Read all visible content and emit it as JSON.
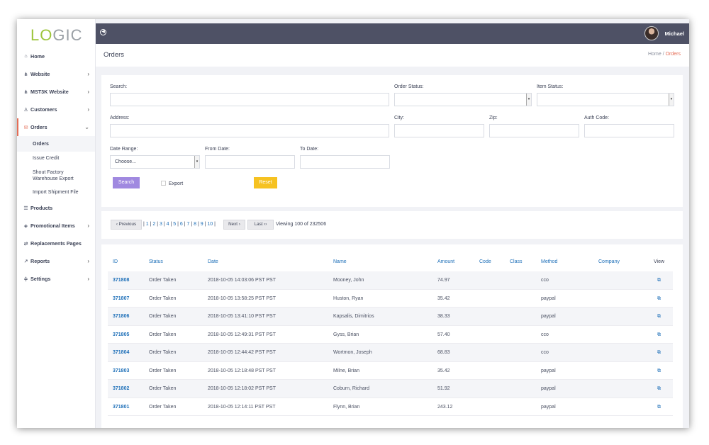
{
  "app": {
    "logo_a": "LO",
    "logo_b": "GIC",
    "user": "Michael"
  },
  "sidebar": {
    "items": [
      {
        "label": "Home",
        "icon": "home-icon",
        "glyph": "⌂"
      },
      {
        "label": "Website",
        "icon": "sitemap-icon",
        "glyph": "⋔"
      },
      {
        "label": "MST3K Website",
        "icon": "sitemap-icon",
        "glyph": "⋔"
      },
      {
        "label": "Customers",
        "icon": "users-icon",
        "glyph": "♙"
      },
      {
        "label": "Orders",
        "icon": "envelope-icon",
        "glyph": "✉"
      },
      {
        "label": "Products",
        "icon": "list-icon",
        "glyph": "☰"
      },
      {
        "label": "Promotional Items",
        "icon": "tags-icon",
        "glyph": "◈"
      },
      {
        "label": "Replacements Pages",
        "icon": "exchange-icon",
        "glyph": "⇄"
      },
      {
        "label": "Reports",
        "icon": "chart-icon",
        "glyph": "↗"
      },
      {
        "label": "Settings",
        "icon": "sliders-icon",
        "glyph": "≑"
      }
    ],
    "orders_sub": [
      "Orders",
      "Issue Credit",
      "Shout Factory Warehouse Export",
      "Import Shipment File"
    ]
  },
  "header": {
    "title": "Orders",
    "crumb_home": "Home",
    "crumb_sep": "/",
    "crumb_current": "Orders"
  },
  "filters": {
    "search": "Search:",
    "order_status": "Order Status:",
    "item_status": "Item Status:",
    "address": "Address:",
    "city": "City:",
    "zip": "Zip:",
    "auth_code": "Auth Code:",
    "date_range": "Date Range:",
    "date_range_value": "Choose...",
    "from_date": "From Date:",
    "to_date": "To Date:",
    "search_btn": "Search",
    "export": "Export",
    "reset_btn": "Reset"
  },
  "pagination": {
    "previous": "‹ Previous",
    "pages": [
      "1",
      "2",
      "3",
      "4",
      "5",
      "6",
      "7",
      "8",
      "9",
      "10"
    ],
    "next": "Next ›",
    "last": "Last ››",
    "viewing": "Viewing 100 of 232506"
  },
  "table": {
    "headers": [
      "ID",
      "Status",
      "Date",
      "Name",
      "Amount",
      "Code",
      "Class",
      "Method",
      "Company",
      "View"
    ],
    "rows": [
      {
        "id": "371808",
        "status": "Order Taken",
        "date": "2018-10-05 14:03:06 PST PST",
        "name": "Mooney, John",
        "amount": "74.97",
        "method": "cco"
      },
      {
        "id": "371807",
        "status": "Order Taken",
        "date": "2018-10-05 13:58:25 PST PST",
        "name": "Huston, Ryan",
        "amount": "35.42",
        "method": "paypal"
      },
      {
        "id": "371806",
        "status": "Order Taken",
        "date": "2018-10-05 13:41:10 PST PST",
        "name": "Kapsalis, Dimitrios",
        "amount": "38.33",
        "method": "paypal"
      },
      {
        "id": "371805",
        "status": "Order Taken",
        "date": "2018-10-05 12:49:31 PST PST",
        "name": "Gyss, Brian",
        "amount": "57.40",
        "method": "cco"
      },
      {
        "id": "371804",
        "status": "Order Taken",
        "date": "2018-10-05 12:44:42 PST PST",
        "name": "Wortmon, Joseph",
        "amount": "68.83",
        "method": "cco"
      },
      {
        "id": "371803",
        "status": "Order Taken",
        "date": "2018-10-05 12:18:48 PST PST",
        "name": "Milne, Brian",
        "amount": "35.42",
        "method": "paypal"
      },
      {
        "id": "371802",
        "status": "Order Taken",
        "date": "2018-10-05 12:18:02 PST PST",
        "name": "Coburn, Richard",
        "amount": "51.92",
        "method": "paypal"
      },
      {
        "id": "371801",
        "status": "Order Taken",
        "date": "2018-10-05 12:14:11 PST PST",
        "name": "Flynn, Brian",
        "amount": "243.12",
        "method": "paypal"
      }
    ]
  },
  "colors": {
    "accent": "#e56d56",
    "topbar": "#4e5165",
    "link": "#1d6fb8",
    "search_btn": "#a089e0",
    "reset_btn": "#f6c221",
    "logo_green": "#9dc53b"
  }
}
